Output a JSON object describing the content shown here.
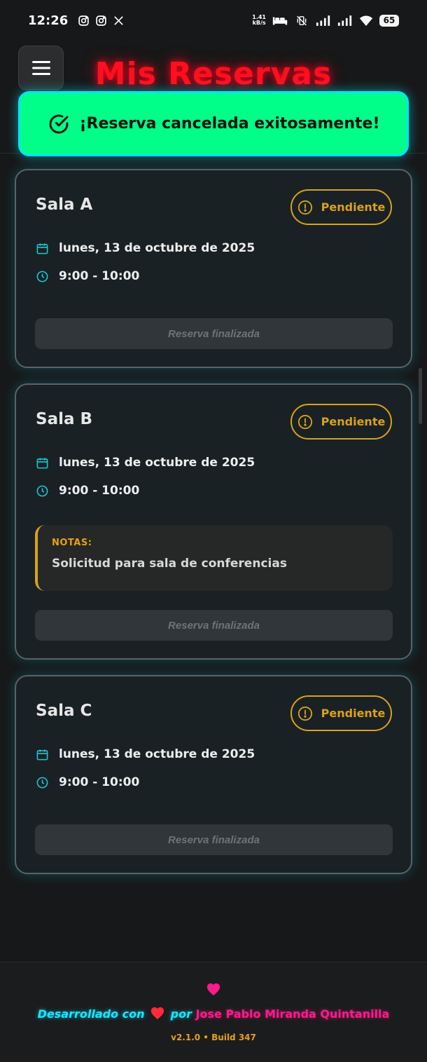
{
  "status_bar": {
    "time": "12:26",
    "network_speed_value": "1.41",
    "network_speed_unit": "kB/s",
    "battery": "65",
    "left_icons": [
      "instagram-icon",
      "instagram-icon",
      "x-icon"
    ],
    "right_icons": [
      "bed-icon",
      "vibrate-off-icon",
      "signal-icon",
      "signal-icon",
      "wifi-icon",
      "battery-icon"
    ]
  },
  "header": {
    "title": "Mis Reservas",
    "menu_icon": "hamburger-menu-icon",
    "title_color": "#ff0f1e"
  },
  "toast": {
    "message": "¡Reserva cancelada exitosamente!",
    "icon": "check-circle-icon",
    "background": "#00ff88",
    "border": "#00e5ff"
  },
  "reservations": [
    {
      "room": "Sala A",
      "status": "Pendiente",
      "date": "lunes, 13 de octubre de 2025",
      "time": "9:00 - 10:00",
      "action": "Reserva finalizada"
    },
    {
      "room": "Sala B",
      "status": "Pendiente",
      "date": "lunes, 13 de octubre de 2025",
      "time": "9:00 - 10:00",
      "notes_label": "NOTAS:",
      "notes": "Solicitud para sala de conferencias",
      "action": "Reserva finalizada"
    },
    {
      "room": "Sala C",
      "status": "Pendiente",
      "date": "lunes, 13 de octubre de 2025",
      "time": "9:00 - 10:00",
      "action": "Reserva finalizada"
    }
  ],
  "footer": {
    "credit_prefix": "Desarrollado con",
    "credit_by": "por",
    "author": "Jose Pablo Miranda Quintanilla",
    "version": "v2.1.0 • Build 347"
  },
  "colors": {
    "accent_cyan": "#19e6ff",
    "pending": "#d9a21b",
    "pink": "#ff1a8c"
  }
}
